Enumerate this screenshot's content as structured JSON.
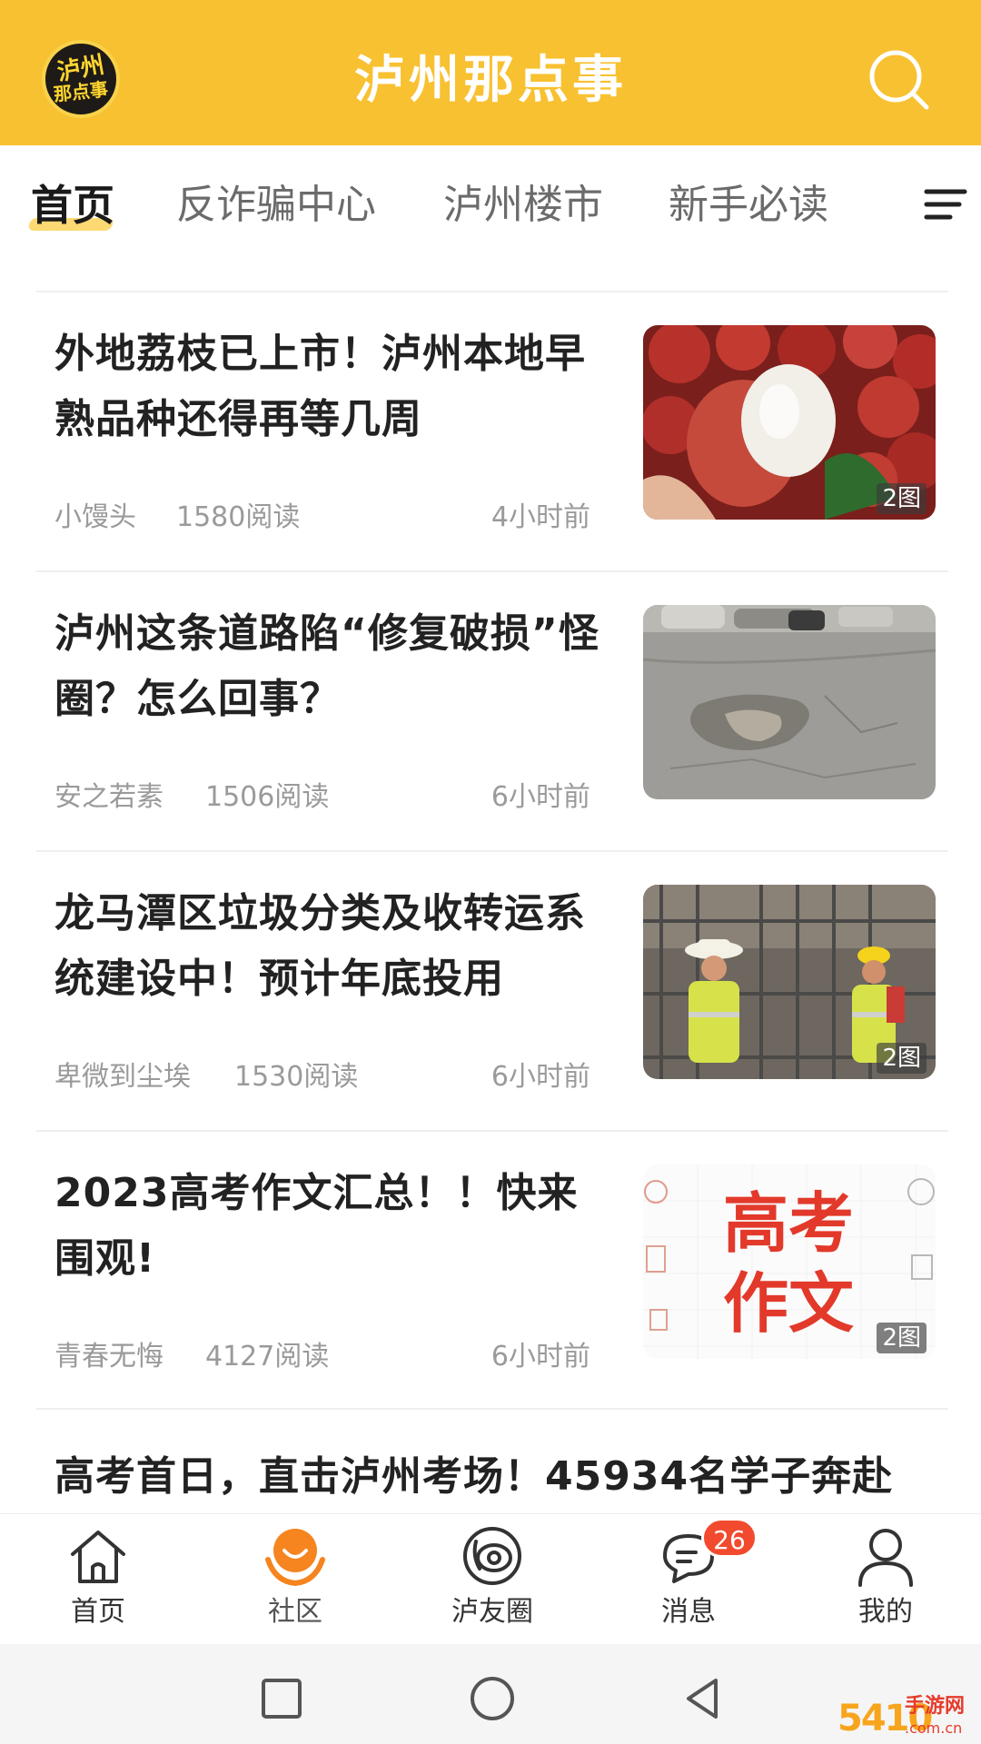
{
  "header": {
    "app_title": "泸州那点事",
    "logo_text_line1": "泸州",
    "logo_text_line2": "那点事",
    "brand_color": "#f8c131",
    "search_icon": "search-icon"
  },
  "tabs": {
    "items": [
      {
        "label": "首页",
        "active": true
      },
      {
        "label": "反诈骗中心",
        "active": false
      },
      {
        "label": "泸州楼市",
        "active": false
      },
      {
        "label": "新手必读",
        "active": false
      }
    ],
    "menu_icon": "menu-icon"
  },
  "articles": [
    {
      "title": "外地荔枝已上市！泸州本地早熟品种还得再等几周",
      "author": "小馒头",
      "reads": "1580阅读",
      "time": "4小时前",
      "image_badge": "2图"
    },
    {
      "title": "泸州这条道路陷“修复破损”怪圈？怎么回事？",
      "author": "安之若素",
      "reads": "1506阅读",
      "time": "6小时前",
      "image_badge": ""
    },
    {
      "title": "龙马潭区垃圾分类及收转运系统建设中！预计年底投用",
      "author": "卑微到尘埃",
      "reads": "1530阅读",
      "time": "6小时前",
      "image_badge": "2图"
    },
    {
      "title": "2023高考作文汇总！！快来围观!",
      "author": "青春无悔",
      "reads": "4127阅读",
      "time": "6小时前",
      "image_badge": "2图",
      "image_text_line1": "高考",
      "image_text_line2": "作文"
    },
    {
      "title": "高考首日，直击泸州考场！45934名学子奔赴"
    }
  ],
  "bottom_nav": {
    "items": [
      {
        "label": "首页",
        "icon": "home-icon"
      },
      {
        "label": "社区",
        "icon": "community-icon",
        "active": true
      },
      {
        "label": "泸友圈",
        "icon": "circle-icon"
      },
      {
        "label": "消息",
        "icon": "message-icon",
        "badge": "26"
      },
      {
        "label": "我的",
        "icon": "profile-icon"
      }
    ]
  },
  "system_nav": {
    "recent_icon": "recent-apps-icon",
    "home_icon": "home-circle-icon",
    "back_icon": "back-icon"
  },
  "watermark": {
    "number": "5410",
    "text": "手游网",
    "sub": ".com.cn"
  }
}
